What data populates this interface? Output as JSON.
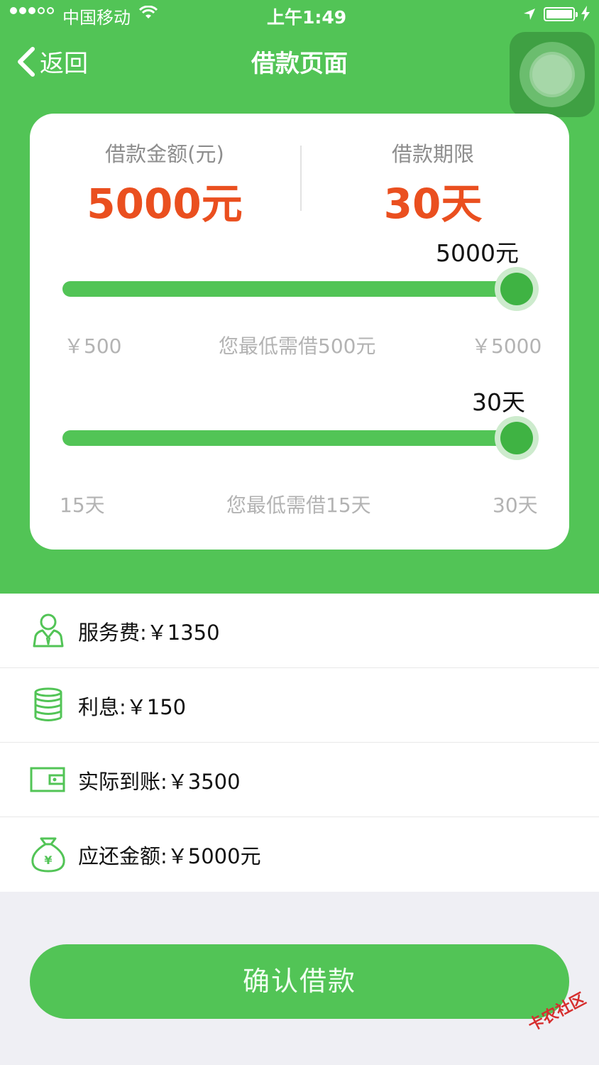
{
  "status_bar": {
    "carrier": "中国移动",
    "time": "上午1:49"
  },
  "nav": {
    "back_label": "返回",
    "title": "借款页面"
  },
  "card": {
    "amount_label": "借款金额(元)",
    "amount_value": "5000元",
    "term_label": "借款期限",
    "term_value": "30天"
  },
  "amount_slider": {
    "current_label": "5000元",
    "level": 1.0,
    "min_label": "￥500",
    "hint": "您最低需借500元",
    "max_label": "￥5000"
  },
  "term_slider": {
    "current_label": "30天",
    "level": 1.0,
    "min_label": "15天",
    "hint": "您最低需借15天",
    "max_label": "30天"
  },
  "info": [
    {
      "icon": "person-icon",
      "text": "服务费:￥1350"
    },
    {
      "icon": "coins-icon",
      "text": "利息:￥150"
    },
    {
      "icon": "wallet-icon",
      "text": "实际到账:￥3500"
    },
    {
      "icon": "money-bag-icon",
      "text": "应还金额:￥5000元"
    }
  ],
  "confirm_label": "确认借款",
  "watermark": "卡农社区",
  "colors": {
    "brand_green": "#52c456",
    "accent_red": "#ea4f1f"
  }
}
